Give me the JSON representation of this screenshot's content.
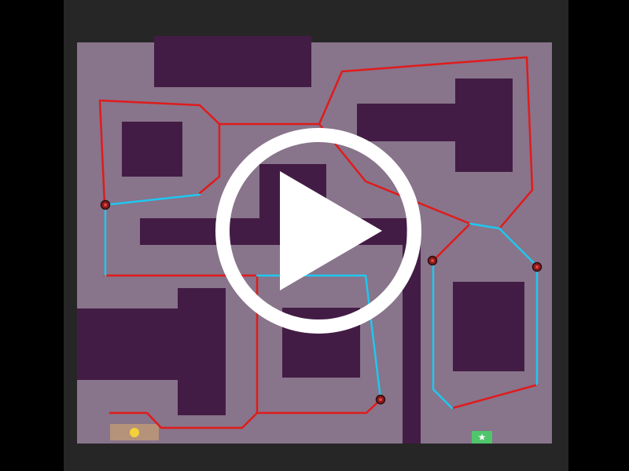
{
  "colors": {
    "background": "#000000",
    "frame": "#262626",
    "floor": "#88748b",
    "wall": "#431c45",
    "laser_path": "#e01b1b",
    "safe_path": "#1ec8f0",
    "start_pad": "#b5937a",
    "player": "#f3d13a",
    "goal": "#4fc56c",
    "play_overlay": "#ffffff"
  },
  "icons": {
    "play": "play-icon",
    "goal": "star-icon",
    "player": "player-dot",
    "enemy": "guard-icon"
  },
  "goal": {
    "symbol": "★"
  },
  "overlay": {
    "state": "paused"
  }
}
